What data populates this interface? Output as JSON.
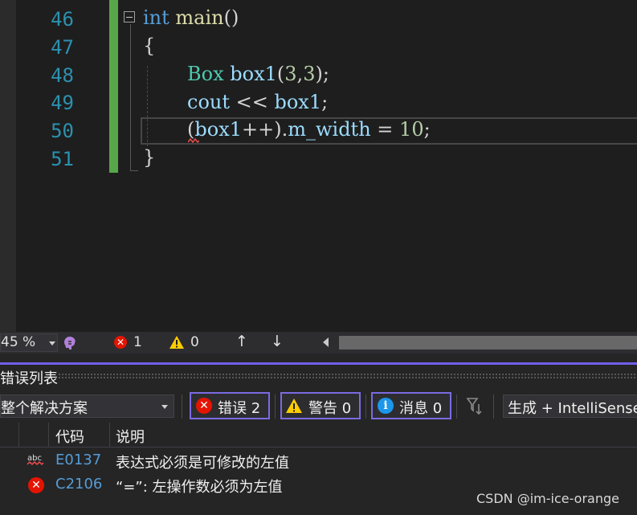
{
  "editor": {
    "line_numbers": [
      "46",
      "47",
      "48",
      "49",
      "50",
      "51"
    ],
    "lines": [
      {
        "kw": "int",
        "fn": "main",
        "rest": "()"
      },
      {
        "text": "{"
      },
      {
        "type": "Box",
        "var": "box1",
        "open": "(",
        "n1": "3",
        "comma": ",",
        "n2": "3",
        "close": ");"
      },
      {
        "var1": "cout",
        "op": " << ",
        "var2": "box1",
        "end": ";"
      },
      {
        "open": "(",
        "var": "box1",
        "mid": "++).",
        "member": "m_width",
        "op": " = ",
        "num": "10",
        "end": ";"
      },
      {
        "text": "}"
      }
    ]
  },
  "status": {
    "zoom": "45 %",
    "error_count": "1",
    "warning_count": "0",
    "up_arrow": "↑",
    "down_arrow": "↓"
  },
  "error_list": {
    "title": "错误列表",
    "scope": "整个解决方案",
    "errors_filter": "错误 2",
    "warnings_filter": "警告 0",
    "messages_filter": "消息 0",
    "source": "生成 + IntelliSense",
    "columns": {
      "code": "代码",
      "description": "说明"
    },
    "rows": [
      {
        "icon": "intellisense-abc-icon",
        "code": "E0137",
        "description": "表达式必须是可修改的左值"
      },
      {
        "icon": "error-icon",
        "code": "C2106",
        "description": "“=”: 左操作数必须为左值"
      }
    ]
  },
  "watermark": "CSDN @im-ice-orange",
  "colors": {
    "keyword": "#569cd6",
    "function": "#dcdcaa",
    "type": "#4ec9b0",
    "variable": "#9cdcfe",
    "number": "#b5cea8",
    "line_number": "#2b91af",
    "change_bar": "#57a64a",
    "error": "#e51400",
    "warning": "#ffcc00",
    "info": "#1c97ea",
    "filter_border": "#7a6be0"
  }
}
